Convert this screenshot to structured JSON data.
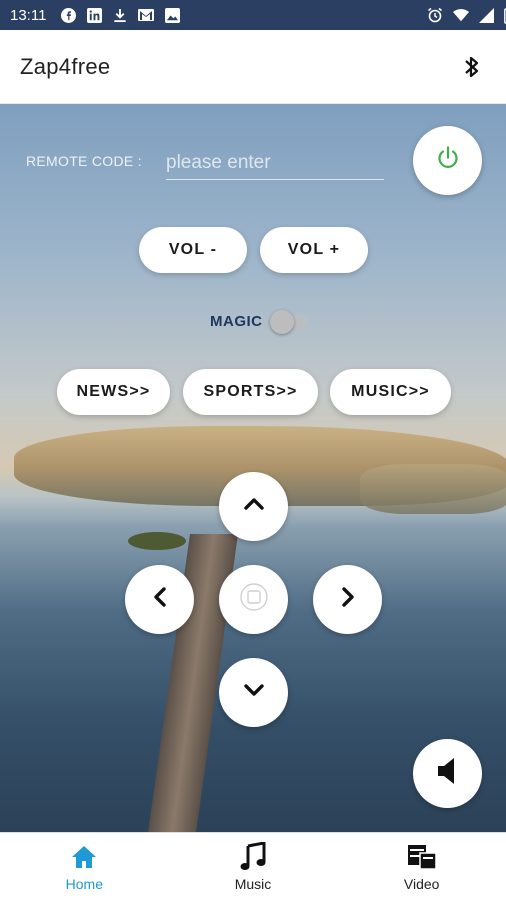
{
  "status_bar": {
    "time": "13:11",
    "left_icons": [
      "facebook-icon",
      "linkedin-icon",
      "download-icon",
      "gmail-icon",
      "image-icon"
    ],
    "right_icons": [
      "alarm-icon",
      "wifi-icon",
      "signal-icon",
      "battery-icon"
    ]
  },
  "app_bar": {
    "title": "Zap4free",
    "action_icon": "bluetooth-icon"
  },
  "remote": {
    "code_label": "REMOTE CODE :",
    "code_placeholder": "please enter",
    "code_value": "",
    "power_icon": "power-icon",
    "vol_down_label": "VOL -",
    "vol_up_label": "VOL +",
    "magic_label": "MAGIC",
    "magic_enabled": false,
    "channels": {
      "news_label": "NEWS>>",
      "sports_label": "SPORTS>>",
      "music_label": "MUSIC>>"
    },
    "dpad_icons": [
      "chevron-up-icon",
      "chevron-left-icon",
      "ok-icon",
      "chevron-right-icon",
      "chevron-down-icon"
    ],
    "mute_icon": "speaker-icon"
  },
  "bottom_nav": {
    "items": [
      {
        "label": "Home",
        "icon": "home-icon",
        "active": true
      },
      {
        "label": "Music",
        "icon": "music-note-icon",
        "active": false
      },
      {
        "label": "Video",
        "icon": "video-icon",
        "active": false
      }
    ]
  },
  "colors": {
    "status_bar": "#2b3f63",
    "active_nav": "#1f9ad6",
    "power_green": "#3bb04a",
    "magic_label": "#20385e"
  }
}
